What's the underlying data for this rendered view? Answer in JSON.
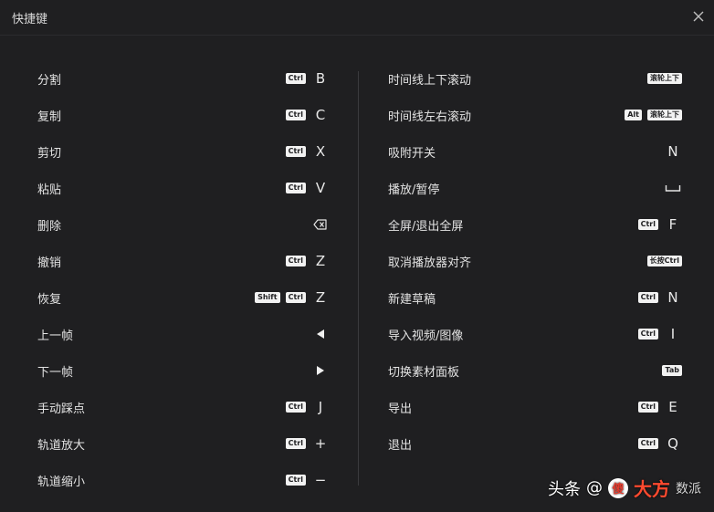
{
  "window": {
    "title": "快捷键"
  },
  "left": [
    {
      "label": "分割",
      "keys": [
        {
          "t": "pill",
          "v": "Ctrl"
        },
        {
          "t": "letter",
          "v": "B"
        }
      ]
    },
    {
      "label": "复制",
      "keys": [
        {
          "t": "pill",
          "v": "Ctrl"
        },
        {
          "t": "letter",
          "v": "C"
        }
      ]
    },
    {
      "label": "剪切",
      "keys": [
        {
          "t": "pill",
          "v": "Ctrl"
        },
        {
          "t": "letter",
          "v": "X"
        }
      ]
    },
    {
      "label": "粘贴",
      "keys": [
        {
          "t": "pill",
          "v": "Ctrl"
        },
        {
          "t": "letter",
          "v": "V"
        }
      ]
    },
    {
      "label": "删除",
      "keys": [
        {
          "t": "icon",
          "v": "backspace-icon"
        }
      ]
    },
    {
      "label": "撤销",
      "keys": [
        {
          "t": "pill",
          "v": "Ctrl"
        },
        {
          "t": "letter",
          "v": "Z"
        }
      ]
    },
    {
      "label": "恢复",
      "keys": [
        {
          "t": "pill",
          "v": "Shift"
        },
        {
          "t": "pill",
          "v": "Ctrl"
        },
        {
          "t": "letter",
          "v": "Z"
        }
      ]
    },
    {
      "label": "上一帧",
      "keys": [
        {
          "t": "icon",
          "v": "arrow-left-icon"
        }
      ]
    },
    {
      "label": "下一帧",
      "keys": [
        {
          "t": "icon",
          "v": "arrow-right-icon"
        }
      ]
    },
    {
      "label": "手动踩点",
      "keys": [
        {
          "t": "pill",
          "v": "Ctrl"
        },
        {
          "t": "letter",
          "v": "J"
        }
      ]
    },
    {
      "label": "轨道放大",
      "keys": [
        {
          "t": "pill",
          "v": "Ctrl"
        },
        {
          "t": "letter",
          "v": "+"
        }
      ]
    },
    {
      "label": "轨道缩小",
      "keys": [
        {
          "t": "pill",
          "v": "Ctrl"
        },
        {
          "t": "letter",
          "v": "−"
        }
      ]
    }
  ],
  "right": [
    {
      "label": "时间线上下滚动",
      "keys": [
        {
          "t": "pill",
          "v": "滚轮上下"
        }
      ]
    },
    {
      "label": "时间线左右滚动",
      "keys": [
        {
          "t": "pill",
          "v": "Alt"
        },
        {
          "t": "pill",
          "v": "滚轮上下"
        }
      ]
    },
    {
      "label": "吸附开关",
      "keys": [
        {
          "t": "letter",
          "v": "N"
        }
      ]
    },
    {
      "label": "播放/暂停",
      "keys": [
        {
          "t": "icon",
          "v": "space-bar-icon"
        }
      ]
    },
    {
      "label": "全屏/退出全屏",
      "keys": [
        {
          "t": "pill",
          "v": "Ctrl"
        },
        {
          "t": "letter",
          "v": "F"
        }
      ]
    },
    {
      "label": "取消播放器对齐",
      "keys": [
        {
          "t": "pill",
          "v": "长按Ctrl"
        }
      ]
    },
    {
      "label": "新建草稿",
      "keys": [
        {
          "t": "pill",
          "v": "Ctrl"
        },
        {
          "t": "letter",
          "v": "N"
        }
      ]
    },
    {
      "label": "导入视频/图像",
      "keys": [
        {
          "t": "pill",
          "v": "Ctrl"
        },
        {
          "t": "letter",
          "v": "I"
        }
      ]
    },
    {
      "label": "切换素材面板",
      "keys": [
        {
          "t": "pill",
          "v": "Tab"
        }
      ]
    },
    {
      "label": "导出",
      "keys": [
        {
          "t": "pill",
          "v": "Ctrl"
        },
        {
          "t": "letter",
          "v": "E"
        }
      ]
    },
    {
      "label": "退出",
      "keys": [
        {
          "t": "pill",
          "v": "Ctrl"
        },
        {
          "t": "letter",
          "v": "Q"
        }
      ]
    }
  ],
  "watermark": {
    "brand": "头条",
    "handle": "@",
    "logo": "傻",
    "big": "大方",
    "sub": "数派"
  }
}
